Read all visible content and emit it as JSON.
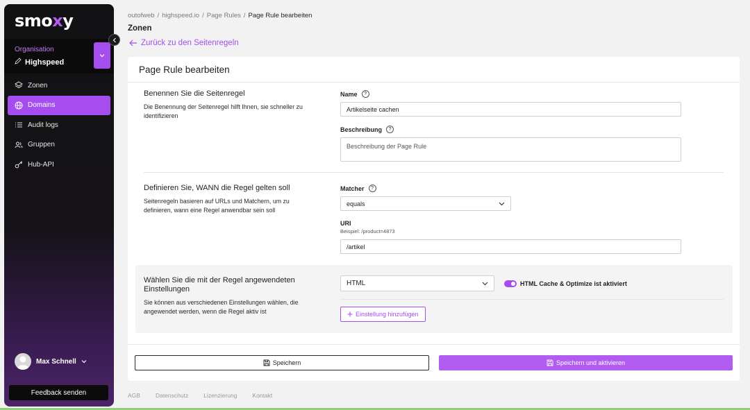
{
  "sidebar": {
    "logo_pre": "smo",
    "logo_x": "x",
    "logo_post": "y",
    "org_label": "Organisation",
    "org_name": "Highspeed",
    "items": [
      {
        "label": "Zonen",
        "icon": "layers-icon"
      },
      {
        "label": "Domains",
        "icon": "globe-icon",
        "active": true
      },
      {
        "label": "Audit logs",
        "icon": "list-icon"
      },
      {
        "label": "Gruppen",
        "icon": "users-icon"
      },
      {
        "label": "Hub-API",
        "icon": "key-icon"
      }
    ],
    "user_name": "Max Schnell",
    "feedback": "Feedback senden"
  },
  "breadcrumb": [
    "outofweb",
    "highspeed.io",
    "Page Rules",
    "Page Rule bearbeiten"
  ],
  "page_title": "Zonen",
  "back_link": "Zurück zu den Seitenregeln",
  "card": {
    "title": "Page Rule bearbeiten",
    "section1": {
      "title": "Benennen Sie die Seitenregel",
      "desc": "Die Benennung der Seitenregel hilft Ihnen, sie schneller zu identifizieren",
      "name_label": "Name",
      "name_value": "Artikelseite cachen",
      "desc_label": "Beschreibung",
      "desc_placeholder": "Beschreibung der Page Rule"
    },
    "section2": {
      "title": "Definieren Sie, WANN die Regel gelten soll",
      "desc": "Seitenregeln basieren auf URLs und Matchern, um zu definieren, wann eine Regel anwendbar sein soll",
      "matcher_label": "Matcher",
      "matcher_value": "equals",
      "uri_label": "URI",
      "uri_hint": "Beispiel: /product=4873",
      "uri_value": "/artikel"
    },
    "section3": {
      "title": "Wählen Sie die mit der Regel angewendeten Einstellungen",
      "desc": "Sie können aus verschiedenen Einstellungen wählen, die angewendet werden, wenn die Regel aktiv ist",
      "setting_value": "HTML",
      "toggle_label": "HTML Cache & Optimize ist aktiviert",
      "toggle_on": true,
      "add_label": "Einstellung hinzufügen"
    },
    "save_label": "Speichern",
    "save_activate_label": "Speichern und aktivieren"
  },
  "footer": [
    "AGB",
    "Datenschutz",
    "Lizenzierung",
    "Kontakt"
  ],
  "colors": {
    "accent": "#a64df0",
    "sidebar_bg": "#121214"
  }
}
